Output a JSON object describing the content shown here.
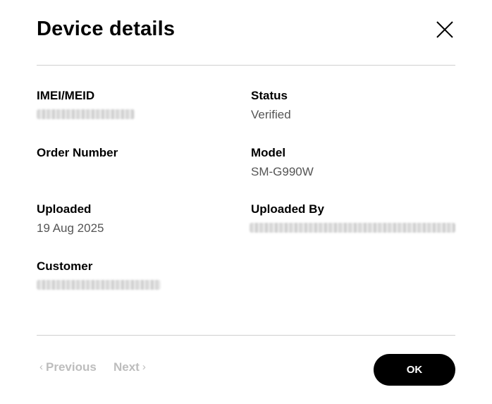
{
  "dialog": {
    "title": "Device details",
    "close_icon": "close-icon"
  },
  "fields": {
    "imei": {
      "label": "IMEI/MEID",
      "value": ""
    },
    "status": {
      "label": "Status",
      "value": "Verified"
    },
    "order_number": {
      "label": "Order Number",
      "value": ""
    },
    "model": {
      "label": "Model",
      "value": "SM-G990W"
    },
    "uploaded": {
      "label": "Uploaded",
      "value": "19 Aug 2025"
    },
    "uploaded_by": {
      "label": "Uploaded By",
      "value": ""
    },
    "customer": {
      "label": "Customer",
      "value": ""
    }
  },
  "footer": {
    "previous_label": "Previous",
    "next_label": "Next",
    "ok_label": "OK",
    "prev_icon": "chevron-left-icon",
    "next_icon": "chevron-right-icon"
  },
  "colors": {
    "primary_button": "#000000",
    "primary_button_text": "#ffffff",
    "disabled_text": "#bdbdbd",
    "value_text": "#555555",
    "divider": "#cfcfcf"
  }
}
